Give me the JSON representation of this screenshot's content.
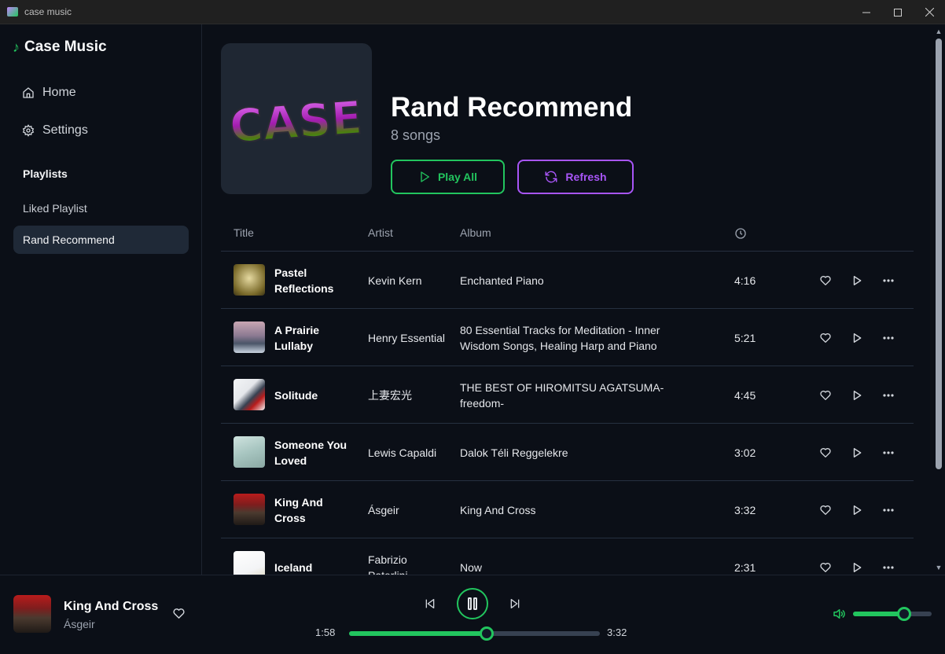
{
  "window": {
    "title": "case music"
  },
  "sidebar": {
    "brand": "Case Music",
    "nav": [
      {
        "label": "Home",
        "icon": "home-icon"
      },
      {
        "label": "Settings",
        "icon": "gear-icon"
      }
    ],
    "playlists_title": "Playlists",
    "playlists": [
      {
        "label": "Liked Playlist",
        "active": false
      },
      {
        "label": "Rand Recommend",
        "active": true
      }
    ]
  },
  "playlist": {
    "cover_text": "CASE",
    "title": "Rand Recommend",
    "count": "8 songs",
    "play_all": "Play All",
    "refresh": "Refresh"
  },
  "table": {
    "headers": {
      "title": "Title",
      "artist": "Artist",
      "album": "Album",
      "duration_icon": "clock-icon"
    },
    "rows": [
      {
        "title": "Pastel Reflections",
        "artist": "Kevin Kern",
        "album": "Enchanted Piano",
        "duration": "4:16"
      },
      {
        "title": "A Prairie Lullaby",
        "artist": "Henry Essential",
        "album": "80 Essential Tracks for Meditation - Inner Wisdom Songs, Healing Harp and Piano",
        "duration": "5:21"
      },
      {
        "title": "Solitude",
        "artist": "上妻宏光",
        "album": "THE BEST OF HIROMITSU AGATSUMA-freedom-",
        "duration": "4:45"
      },
      {
        "title": "Someone You Loved",
        "artist": "Lewis Capaldi",
        "album": "Dalok Téli Reggelekre",
        "duration": "3:02"
      },
      {
        "title": "King And Cross",
        "artist": "Ásgeir",
        "album": "King And Cross",
        "duration": "3:32"
      },
      {
        "title": "Iceland",
        "artist": "Fabrizio Paterlini",
        "album": "Now",
        "duration": "2:31"
      }
    ]
  },
  "player": {
    "title": "King And Cross",
    "artist": "Ásgeir",
    "elapsed": "1:58",
    "total": "3:32",
    "progress": 0.55,
    "volume": 0.65,
    "state": "playing"
  },
  "colors": {
    "accent": "#22c55e",
    "refresh": "#a855f7",
    "background": "#0b0f17",
    "active_item": "#1f2937"
  }
}
